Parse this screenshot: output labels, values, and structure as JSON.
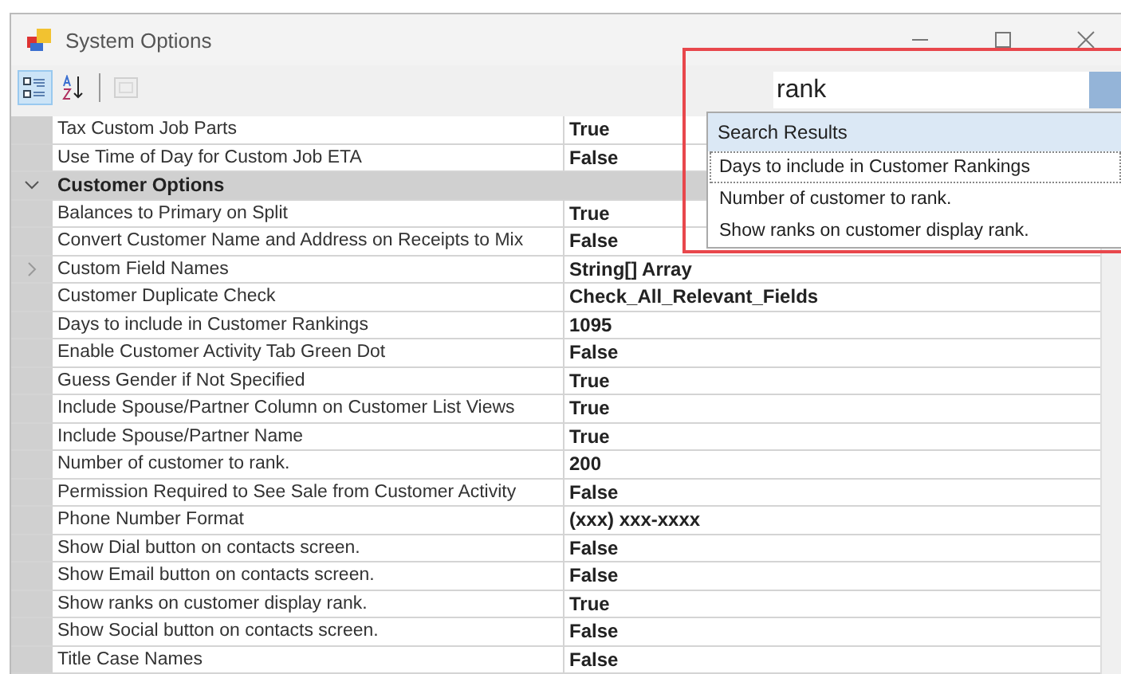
{
  "window": {
    "title": "System Options"
  },
  "toolbar": [
    {
      "kind": "categorized",
      "selected": true,
      "disabled": false
    },
    {
      "kind": "alphabetical",
      "selected": false,
      "disabled": false
    },
    {
      "kind": "pages",
      "selected": false,
      "disabled": true
    }
  ],
  "grid": {
    "rows": [
      {
        "kind": "property",
        "name": "Tax Custom Job Parts",
        "value": "True"
      },
      {
        "kind": "property",
        "name": "Use Time of Day for Custom Job ETA",
        "value": "False"
      },
      {
        "kind": "category",
        "name": "Customer Options",
        "expanded": true
      },
      {
        "kind": "property",
        "name": "Balances to Primary on Split",
        "value": "True"
      },
      {
        "kind": "property",
        "name": "Convert Customer Name and Address on Receipts to Mix",
        "value": "False"
      },
      {
        "kind": "property",
        "name": "Custom Field Names",
        "value": "String[] Array",
        "expanded": false
      },
      {
        "kind": "property",
        "name": "Customer Duplicate Check",
        "value": "Check_All_Relevant_Fields"
      },
      {
        "kind": "property",
        "name": "Days to include in Customer Rankings",
        "value": "1095"
      },
      {
        "kind": "property",
        "name": "Enable Customer Activity Tab Green Dot",
        "value": "False"
      },
      {
        "kind": "property",
        "name": "Guess Gender if Not Specified",
        "value": "True"
      },
      {
        "kind": "property",
        "name": "Include Spouse/Partner Column on Customer List Views",
        "value": "True"
      },
      {
        "kind": "property",
        "name": "Include Spouse/Partner Name",
        "value": "True"
      },
      {
        "kind": "property",
        "name": "Number of customer to rank.",
        "value": "200"
      },
      {
        "kind": "property",
        "name": "Permission Required to See Sale from Customer Activity",
        "value": "False"
      },
      {
        "kind": "property",
        "name": "Phone Number Format",
        "value": "(xxx) xxx-xxxx"
      },
      {
        "kind": "property",
        "name": "Show Dial button on contacts screen.",
        "value": "False"
      },
      {
        "kind": "property",
        "name": "Show Email button on contacts screen.",
        "value": "False"
      },
      {
        "kind": "property",
        "name": "Show ranks on customer display rank.",
        "value": "True"
      },
      {
        "kind": "property",
        "name": "Show Social button on contacts screen.",
        "value": "False"
      },
      {
        "kind": "property",
        "name": "Title Case Names",
        "value": "False"
      }
    ]
  },
  "search": {
    "value": "rank",
    "results_title": "Search Results",
    "results": [
      {
        "label": "Days to include in Customer Rankings",
        "focused": true
      },
      {
        "label": "Number of customer to rank.",
        "focused": false
      },
      {
        "label": "Show ranks on customer display rank.",
        "focused": false
      }
    ]
  }
}
